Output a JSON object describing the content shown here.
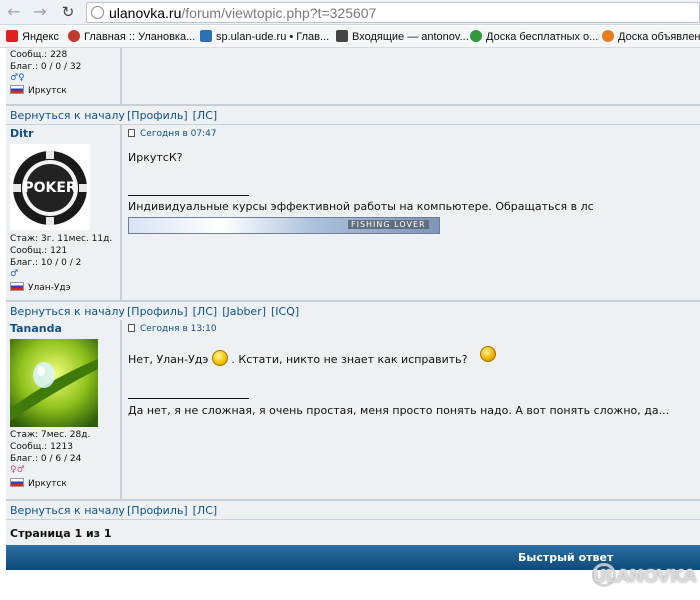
{
  "browser": {
    "address_host": "ulanovka.ru",
    "address_path": "/forum/viewtopic.php?t=325607",
    "bookmarks": [
      {
        "label": "Яндекс",
        "color": "#e02020"
      },
      {
        "label": "Главная :: Улановка...",
        "color": "#c0392b"
      },
      {
        "label": "sp.ulan-ude.ru • Глав...",
        "color": "#2d6fb3"
      },
      {
        "label": "Входящие — antonov...",
        "color": "#444444"
      },
      {
        "label": "Доска бесплатных о...",
        "color": "#2f9a3a"
      },
      {
        "label": "Доска объявлени...",
        "color": "#e67e22"
      }
    ]
  },
  "posts": [
    {
      "stats": [
        "Сообщ.: 228",
        "Благ.: 0 / 0 / 32"
      ],
      "gender": "♂♀",
      "city": "Иркутск",
      "back_label": "Вернуться к началу",
      "links": [
        "[Профиль]",
        "[ЛС]"
      ]
    },
    {
      "author": "Ditr",
      "time": "Сегодня в 07:47",
      "body": "ИркутсК?",
      "signature": "Индивидуальные курсы эффективной работы на компьютере. Обращаться в лс",
      "banner_text": "FISHING LOVER",
      "avatar_text": "POKER",
      "stats": [
        "Стаж: 3г. 11мес. 11д.",
        "Сообщ.: 121",
        "Благ.: 10 / 0 / 2"
      ],
      "gender": "♂",
      "city": "Улан-Удэ",
      "back_label": "Вернуться к началу",
      "links": [
        "[Профиль]",
        "[ЛС]",
        "[Jabber]",
        "[ICQ]"
      ]
    },
    {
      "author": "Tananda",
      "time": "Сегодня в 13:10",
      "body_before": "Нет, Улан-Удэ",
      "body_after": ". Кстати, никто не знает как исправить?",
      "signature": "Да нет, я не сложная, я очень простая, меня просто понять надо. А вот понять сложно, да...",
      "stats": [
        "Стаж: 7мес. 28д.",
        "Сообщ.: 1213",
        "Благ.: 0 / 6 / 24"
      ],
      "gender": "♀♂",
      "city": "Иркутск",
      "back_label": "Вернуться к началу",
      "links": [
        "[Профиль]",
        "[ЛС]"
      ]
    }
  ],
  "pager": "Страница 1 из 1",
  "quick_reply": "Быстрый ответ",
  "watermark": "ULANOVKA"
}
